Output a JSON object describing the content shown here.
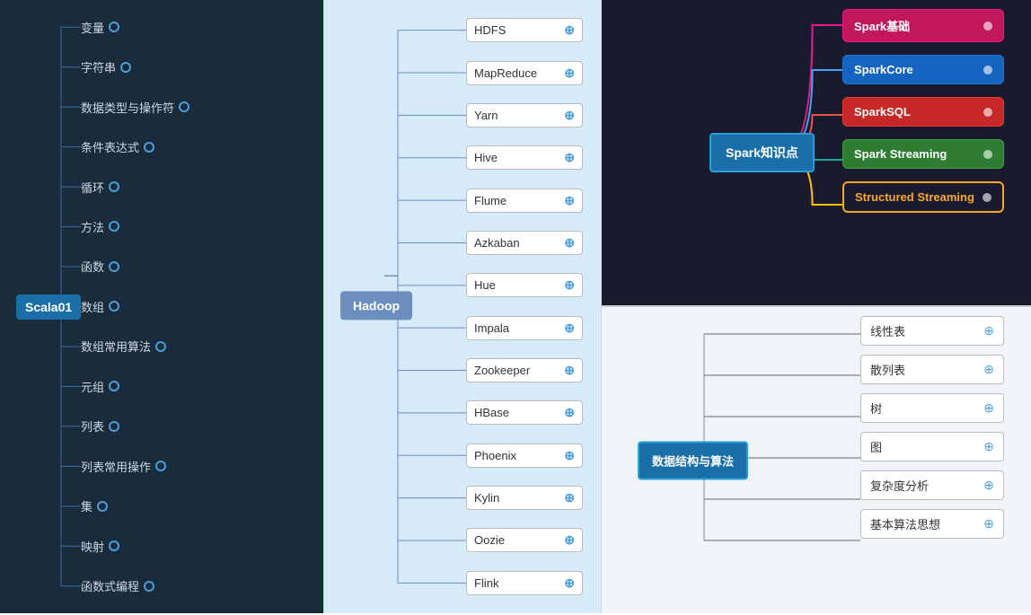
{
  "left": {
    "root": "Scala01",
    "items": [
      {
        "label": "变量"
      },
      {
        "label": "字符串"
      },
      {
        "label": "数据类型与操作符"
      },
      {
        "label": "条件表达式"
      },
      {
        "label": "循环"
      },
      {
        "label": "方法"
      },
      {
        "label": "函数"
      },
      {
        "label": "数组"
      },
      {
        "label": "数组常用算法"
      },
      {
        "label": "元组"
      },
      {
        "label": "列表"
      },
      {
        "label": "列表常用操作"
      },
      {
        "label": "集"
      },
      {
        "label": "映射"
      },
      {
        "label": "函数式编程"
      }
    ]
  },
  "center": {
    "root": "Hadoop",
    "items": [
      {
        "label": "HDFS"
      },
      {
        "label": "MapReduce"
      },
      {
        "label": "Yarn"
      },
      {
        "label": "Hive"
      },
      {
        "label": "Flume"
      },
      {
        "label": "Azkaban"
      },
      {
        "label": "Hue"
      },
      {
        "label": "Impala"
      },
      {
        "label": "Zookeeper"
      },
      {
        "label": "HBase"
      },
      {
        "label": "Phoenix"
      },
      {
        "label": "Kylin"
      },
      {
        "label": "Oozie"
      },
      {
        "label": "Flink"
      }
    ]
  },
  "spark": {
    "root": "Spark知识点",
    "items": [
      {
        "label": "Spark基础",
        "color": "pink"
      },
      {
        "label": "SparkCore",
        "color": "blue"
      },
      {
        "label": "SparkSQL",
        "color": "red"
      },
      {
        "label": "Spark Streaming",
        "color": "green"
      },
      {
        "label": "Structured Streaming",
        "color": "yellow"
      }
    ]
  },
  "ds": {
    "root": "数据结构与算法",
    "items": [
      {
        "label": "线性表"
      },
      {
        "label": "散列表"
      },
      {
        "label": "树"
      },
      {
        "label": "图"
      },
      {
        "label": "复杂度分析"
      },
      {
        "label": "基本算法思想"
      }
    ]
  }
}
